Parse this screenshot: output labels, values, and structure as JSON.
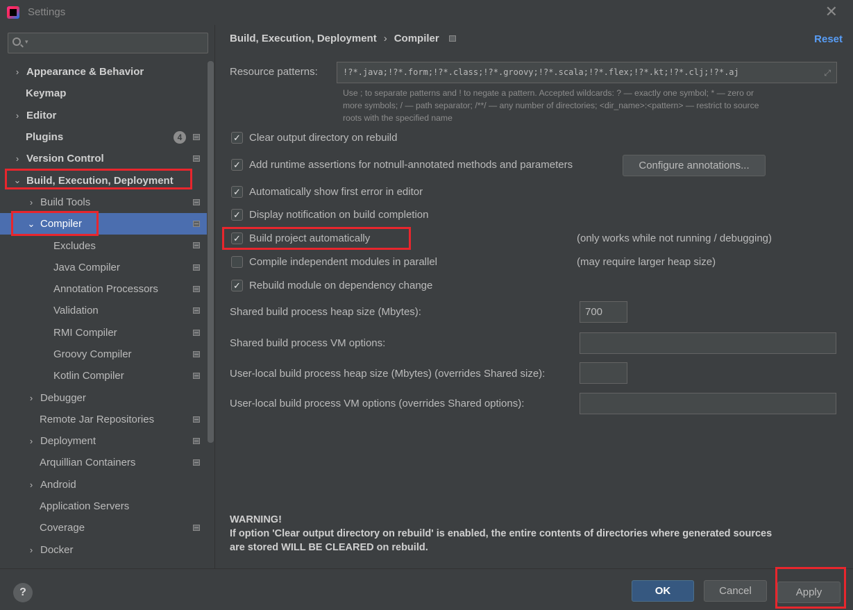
{
  "window": {
    "title": "Settings",
    "close_glyph": "✕"
  },
  "search": {
    "placeholder": "",
    "icon": "search-icon"
  },
  "tree": {
    "appearance": "Appearance & Behavior",
    "keymap": "Keymap",
    "editor": "Editor",
    "plugins": "Plugins",
    "plugins_badge": "4",
    "version_control": "Version Control",
    "build_exec_deploy": "Build, Execution, Deployment",
    "build_tools": "Build Tools",
    "compiler": "Compiler",
    "excludes": "Excludes",
    "java_compiler": "Java Compiler",
    "annotation_processors": "Annotation Processors",
    "validation": "Validation",
    "rmi_compiler": "RMI Compiler",
    "groovy_compiler": "Groovy Compiler",
    "kotlin_compiler": "Kotlin Compiler",
    "debugger": "Debugger",
    "remote_jar": "Remote Jar Repositories",
    "deployment": "Deployment",
    "arquillian": "Arquillian Containers",
    "android": "Android",
    "app_servers": "Application Servers",
    "coverage": "Coverage",
    "docker": "Docker"
  },
  "breadcrumb": {
    "parent": "Build, Execution, Deployment",
    "separator": "›",
    "current": "Compiler"
  },
  "reset_label": "Reset",
  "resource": {
    "label": "Resource patterns:",
    "value": "!?*.java;!?*.form;!?*.class;!?*.groovy;!?*.scala;!?*.flex;!?*.kt;!?*.clj;!?*.aj",
    "help_line1": "Use ; to separate patterns and ! to negate a pattern. Accepted wildcards: ? — exactly one symbol; * — zero or",
    "help_line2": "more symbols; / — path separator; /**/ — any number of directories; <dir_name>:<pattern> — restrict to source",
    "help_line3": "roots with the specified name"
  },
  "options": {
    "clear_output": {
      "label": "Clear output directory on rebuild",
      "checked": true
    },
    "runtime_assertions": {
      "label": "Add runtime assertions for notnull-annotated methods and parameters",
      "checked": true
    },
    "show_first_error": {
      "label": "Automatically show first error in editor",
      "checked": true
    },
    "notification": {
      "label": "Display notification on build completion",
      "checked": true
    },
    "build_auto": {
      "label": "Build project automatically",
      "checked": true
    },
    "parallel": {
      "label": "Compile independent modules in parallel",
      "checked": false
    },
    "rebuild_dep": {
      "label": "Rebuild module on dependency change",
      "checked": true
    }
  },
  "check_glyph": "✓",
  "configure_annotations_label": "Configure annotations...",
  "notes": {
    "build_auto": "(only works while not running / debugging)",
    "parallel": "(may require larger heap size)"
  },
  "fields": {
    "shared_heap_label": "Shared build process heap size (Mbytes):",
    "shared_heap_value": "700",
    "shared_vm_label": "Shared build process VM options:",
    "shared_vm_value": "",
    "user_heap_label": "User-local build process heap size (Mbytes) (overrides Shared size):",
    "user_heap_value": "",
    "user_vm_label": "User-local build process VM options (overrides Shared options):",
    "user_vm_value": ""
  },
  "warning": {
    "title": "WARNING!",
    "line1": "If option 'Clear output directory on rebuild' is enabled, the entire contents of directories where generated sources",
    "line2": "are stored WILL BE CLEARED on rebuild."
  },
  "footer": {
    "help": "?",
    "ok": "OK",
    "cancel": "Cancel",
    "apply": "Apply"
  },
  "colors": {
    "background": "#3c3f41",
    "selection": "#4b6eaf",
    "link": "#589df6",
    "highlight_annotation": "#e8262d",
    "ok_button": "#365880"
  }
}
